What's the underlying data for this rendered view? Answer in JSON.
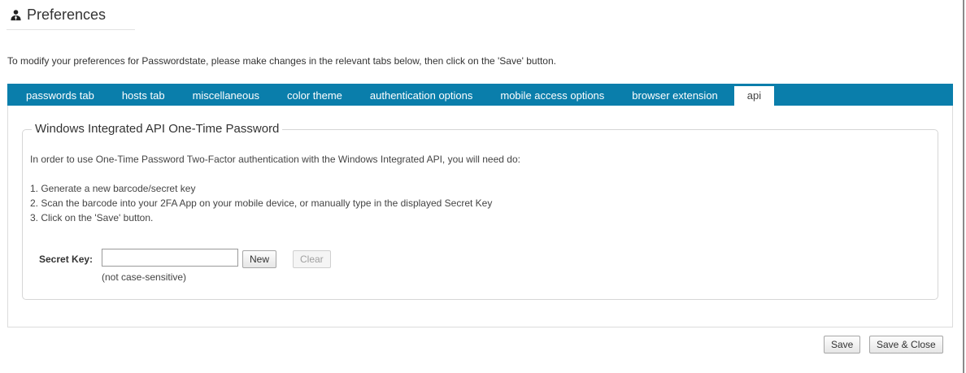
{
  "header": {
    "icon": "user-group-icon",
    "title": "Preferences"
  },
  "intro": "To modify your preferences for Passwordstate, please make changes in the relevant tabs below, then click on the 'Save' button.",
  "tabs": [
    {
      "label": "passwords tab",
      "active": false
    },
    {
      "label": "hosts tab",
      "active": false
    },
    {
      "label": "miscellaneous",
      "active": false
    },
    {
      "label": "color theme",
      "active": false
    },
    {
      "label": "authentication options",
      "active": false
    },
    {
      "label": "mobile access options",
      "active": false
    },
    {
      "label": "browser extension",
      "active": false
    },
    {
      "label": "api",
      "active": true
    }
  ],
  "section": {
    "legend": "Windows Integrated API One-Time Password",
    "description": "In order to use One-Time Password Two-Factor authentication with the Windows Integrated API, you will need do:",
    "steps": [
      "1. Generate a new barcode/secret key",
      "2. Scan the barcode into your 2FA App on your mobile device, or manually type in the displayed Secret Key",
      "3. Click on the 'Save' button."
    ],
    "secret_key": {
      "label": "Secret Key:",
      "value": "",
      "placeholder": "",
      "hint": "(not case-sensitive)"
    },
    "new_label": "New",
    "clear_label": "Clear"
  },
  "footer": {
    "save_label": "Save",
    "save_close_label": "Save & Close"
  },
  "colors": {
    "tab_bar": "#0a7eab",
    "tab_text": "#ffffff"
  }
}
